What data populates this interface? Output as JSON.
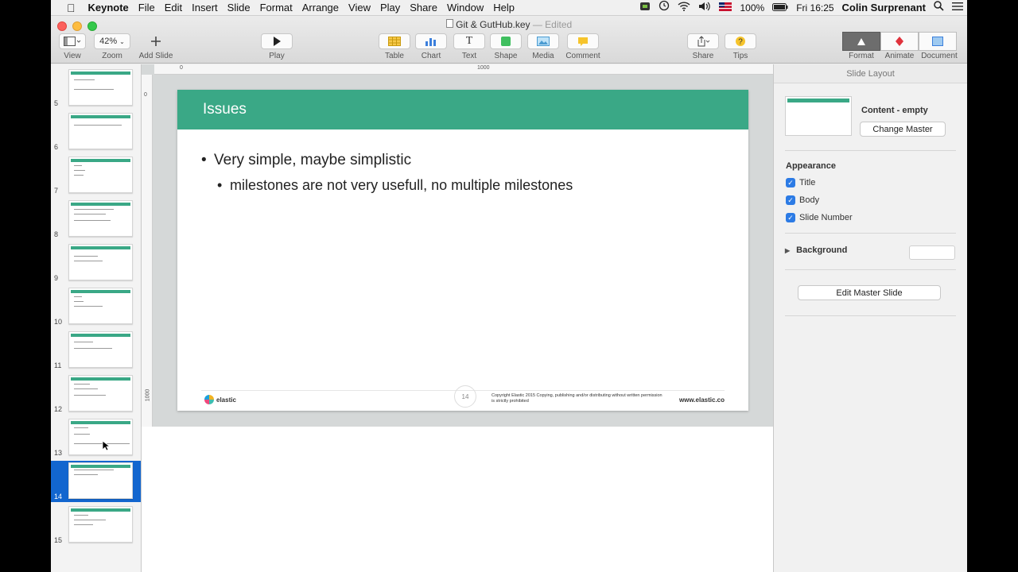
{
  "menubar": {
    "apple": "",
    "app": "Keynote",
    "items": [
      "File",
      "Edit",
      "Insert",
      "Slide",
      "Format",
      "Arrange",
      "View",
      "Play",
      "Share",
      "Window",
      "Help"
    ],
    "battery": "100%",
    "clock": "Fri 16:25",
    "user": "Colin Surprenant"
  },
  "window": {
    "title": "Git & GutHub.key",
    "edited": "— Edited"
  },
  "toolbar": {
    "view_label": "View",
    "zoom_value": "42%",
    "zoom_label": "Zoom",
    "add_slide_label": "Add Slide",
    "play_label": "Play",
    "table_label": "Table",
    "chart_label": "Chart",
    "text_label": "Text",
    "shape_label": "Shape",
    "media_label": "Media",
    "comment_label": "Comment",
    "share_label": "Share",
    "tips_label": "Tips",
    "format_label": "Format",
    "animate_label": "Animate",
    "document_label": "Document"
  },
  "navigator": {
    "slides": [
      {
        "number": "5",
        "selected": false
      },
      {
        "number": "6",
        "selected": false
      },
      {
        "number": "7",
        "selected": false
      },
      {
        "number": "8",
        "selected": false
      },
      {
        "number": "9",
        "selected": false
      },
      {
        "number": "10",
        "selected": false
      },
      {
        "number": "11",
        "selected": false
      },
      {
        "number": "12",
        "selected": false
      },
      {
        "number": "13",
        "selected": false
      },
      {
        "number": "14",
        "selected": true
      },
      {
        "number": "15",
        "selected": false
      }
    ]
  },
  "rulers": {
    "top": [
      "0",
      "1000"
    ],
    "left": [
      "0",
      "1000"
    ]
  },
  "slide": {
    "title": "Issues",
    "bullet1": "Very simple, maybe simplistic",
    "bullet2": "milestones are not very usefull, no multiple milestones",
    "bullet_char": "•",
    "logo_text": "elastic",
    "number": "14",
    "copyright": "Copyright Elastic 2015 Copying, publishing and/or distributing without written permission is strictly prohibited",
    "url": "www.elastic.co",
    "accent_color": "#3aa886"
  },
  "inspector": {
    "tab": "Slide Layout",
    "master_name": "Content - empty",
    "change_master": "Change Master",
    "appearance": "Appearance",
    "checkboxes": [
      "Title",
      "Body",
      "Slide Number"
    ],
    "background": "Background",
    "edit_master": "Edit Master Slide"
  }
}
